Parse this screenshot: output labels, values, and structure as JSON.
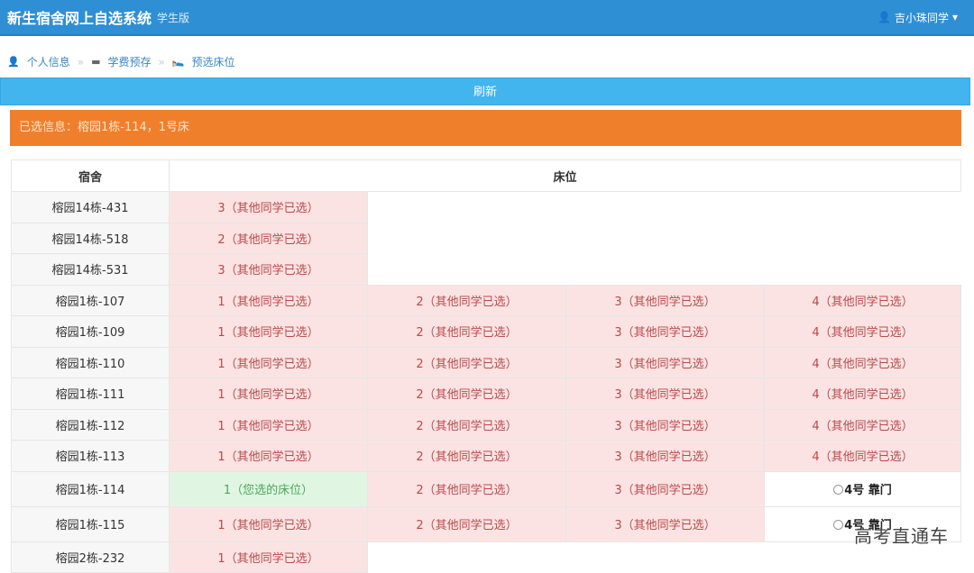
{
  "header": {
    "title": "新生宿舍网上自选系统",
    "subtitle": "学生版",
    "user": "吉小珠同学"
  },
  "breadcrumb": [
    {
      "label": "个人信息",
      "icon": "user-icon"
    },
    {
      "label": "学费预存",
      "icon": "visa-card-icon"
    },
    {
      "label": "预选床位",
      "icon": "bed-icon"
    }
  ],
  "refresh_label": "刷新",
  "selected_info": "已选信息：榕园1栋-114，1号床",
  "table": {
    "headers": [
      "宿舍",
      "床位"
    ],
    "rows": [
      {
        "dorm": "榕园14栋-431",
        "beds": [
          {
            "t": "3（其他同学已选）",
            "s": "taken"
          }
        ]
      },
      {
        "dorm": "榕园14栋-518",
        "beds": [
          {
            "t": "2（其他同学已选）",
            "s": "taken"
          }
        ]
      },
      {
        "dorm": "榕园14栋-531",
        "beds": [
          {
            "t": "3（其他同学已选）",
            "s": "taken"
          }
        ]
      },
      {
        "dorm": "榕园1栋-107",
        "beds": [
          {
            "t": "1（其他同学已选）",
            "s": "taken"
          },
          {
            "t": "2（其他同学已选）",
            "s": "taken"
          },
          {
            "t": "3（其他同学已选）",
            "s": "taken"
          },
          {
            "t": "4（其他同学已选）",
            "s": "taken"
          }
        ]
      },
      {
        "dorm": "榕园1栋-109",
        "beds": [
          {
            "t": "1（其他同学已选）",
            "s": "taken"
          },
          {
            "t": "2（其他同学已选）",
            "s": "taken"
          },
          {
            "t": "3（其他同学已选）",
            "s": "taken"
          },
          {
            "t": "4（其他同学已选）",
            "s": "taken"
          }
        ]
      },
      {
        "dorm": "榕园1栋-110",
        "beds": [
          {
            "t": "1（其他同学已选）",
            "s": "taken"
          },
          {
            "t": "2（其他同学已选）",
            "s": "taken"
          },
          {
            "t": "3（其他同学已选）",
            "s": "taken"
          },
          {
            "t": "4（其他同学已选）",
            "s": "taken"
          }
        ]
      },
      {
        "dorm": "榕园1栋-111",
        "beds": [
          {
            "t": "1（其他同学已选）",
            "s": "taken"
          },
          {
            "t": "2（其他同学已选）",
            "s": "taken"
          },
          {
            "t": "3（其他同学已选）",
            "s": "taken"
          },
          {
            "t": "4（其他同学已选）",
            "s": "taken"
          }
        ]
      },
      {
        "dorm": "榕园1栋-112",
        "beds": [
          {
            "t": "1（其他同学已选）",
            "s": "taken"
          },
          {
            "t": "2（其他同学已选）",
            "s": "taken"
          },
          {
            "t": "3（其他同学已选）",
            "s": "taken"
          },
          {
            "t": "4（其他同学已选）",
            "s": "taken"
          }
        ]
      },
      {
        "dorm": "榕园1栋-113",
        "beds": [
          {
            "t": "1（其他同学已选）",
            "s": "taken"
          },
          {
            "t": "2（其他同学已选）",
            "s": "taken"
          },
          {
            "t": "3（其他同学已选）",
            "s": "taken"
          },
          {
            "t": "4（其他同学已选）",
            "s": "taken"
          }
        ]
      },
      {
        "dorm": "榕园1栋-114",
        "beds": [
          {
            "t": "1（您选的床位）",
            "s": "mine"
          },
          {
            "t": "2（其他同学已选）",
            "s": "taken"
          },
          {
            "t": "3（其他同学已选）",
            "s": "taken"
          },
          {
            "t": "4号 靠门",
            "s": "avail"
          }
        ]
      },
      {
        "dorm": "榕园1栋-115",
        "beds": [
          {
            "t": "1（其他同学已选）",
            "s": "taken"
          },
          {
            "t": "2（其他同学已选）",
            "s": "taken"
          },
          {
            "t": "3（其他同学已选）",
            "s": "taken"
          },
          {
            "t": "4号 靠门",
            "s": "avail"
          }
        ]
      },
      {
        "dorm": "榕园2栋-232",
        "beds": [
          {
            "t": "1（其他同学已选）",
            "s": "taken"
          }
        ]
      }
    ]
  },
  "watermark": "高考直通车"
}
